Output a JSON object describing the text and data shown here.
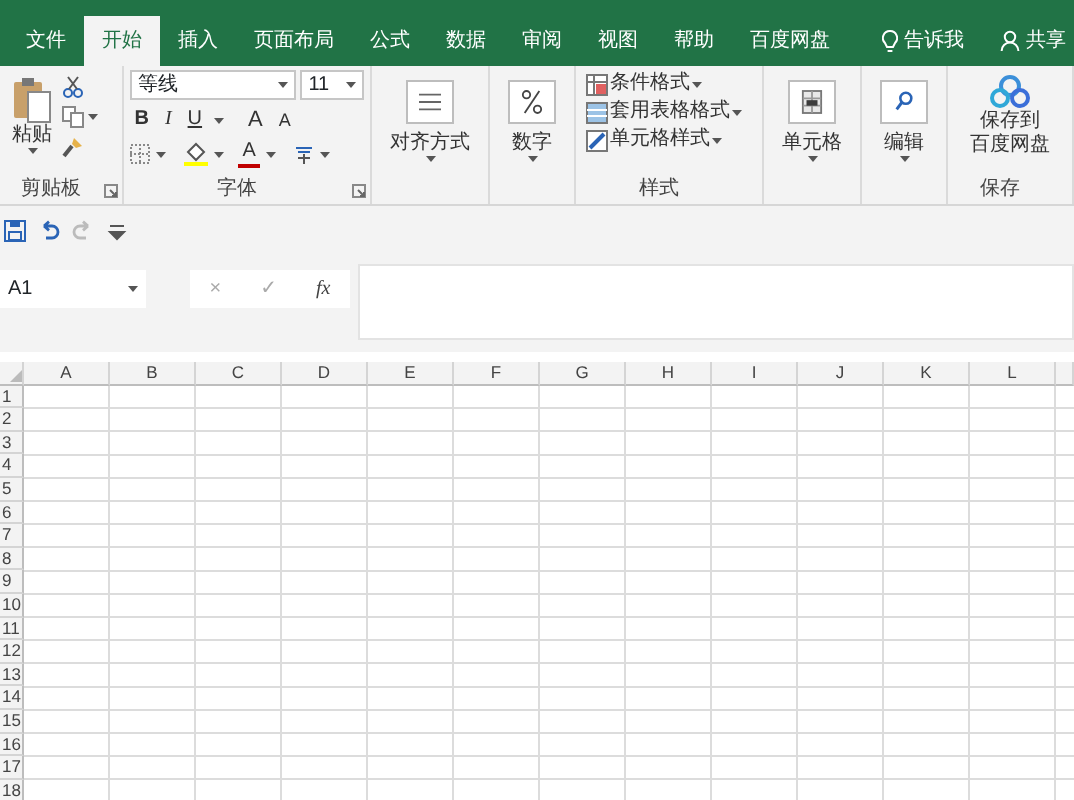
{
  "tabs": [
    {
      "label": "文件",
      "selected": false,
      "kind": "plain"
    },
    {
      "label": "开始",
      "selected": true,
      "kind": "plain"
    },
    {
      "label": "插入",
      "selected": false,
      "kind": "plain"
    },
    {
      "label": "页面布局",
      "selected": false,
      "kind": "plain"
    },
    {
      "label": "公式",
      "selected": false,
      "kind": "plain"
    },
    {
      "label": "数据",
      "selected": false,
      "kind": "plain"
    },
    {
      "label": "审阅",
      "selected": false,
      "kind": "plain"
    },
    {
      "label": "视图",
      "selected": false,
      "kind": "plain"
    },
    {
      "label": "帮助",
      "selected": false,
      "kind": "plain"
    },
    {
      "label": "百度网盘",
      "selected": false,
      "kind": "plain"
    },
    {
      "label": "告诉我",
      "selected": false,
      "kind": "tell"
    },
    {
      "label": "共享",
      "selected": false,
      "kind": "share"
    }
  ],
  "ribbon": {
    "groups": [
      {
        "kind": "clipboard",
        "label": "剪贴板",
        "launcher": true,
        "button": "粘贴"
      },
      {
        "kind": "font",
        "label": "字体",
        "launcher": true,
        "font_name": "等线",
        "font_size": "11",
        "bold": "B",
        "italic": "I",
        "underline": "U",
        "grow": "A",
        "shrink": "A",
        "color_letter": "A"
      },
      {
        "kind": "alignment",
        "button": "对齐方式"
      },
      {
        "kind": "number",
        "button": "数字"
      },
      {
        "kind": "styles",
        "label": "样式",
        "items": [
          "条件格式",
          "套用表格格式",
          "单元格样式"
        ]
      },
      {
        "kind": "cells",
        "button": "单元格"
      },
      {
        "kind": "editing",
        "button": "编辑"
      },
      {
        "kind": "save",
        "label": "保存",
        "lines": [
          "保存到",
          "百度网盘"
        ]
      }
    ]
  },
  "quick_access": [
    {
      "kind": "save",
      "disabled": false
    },
    {
      "kind": "undo",
      "disabled": false
    },
    {
      "kind": "redo",
      "disabled": true
    },
    {
      "kind": "customize",
      "disabled": false
    }
  ],
  "formula_bar": {
    "name_box": "A1",
    "cancel": "×",
    "enter": "✓",
    "function": "fx"
  },
  "sheet": {
    "columns": [
      "A",
      "B",
      "C",
      "D",
      "E",
      "F",
      "G",
      "H",
      "I",
      "J",
      "K",
      "L"
    ],
    "rows": [
      "1",
      "2",
      "3",
      "4",
      "5",
      "6",
      "7",
      "8",
      "9",
      "10",
      "11",
      "12",
      "13",
      "14",
      "15",
      "16",
      "17",
      "18"
    ]
  }
}
